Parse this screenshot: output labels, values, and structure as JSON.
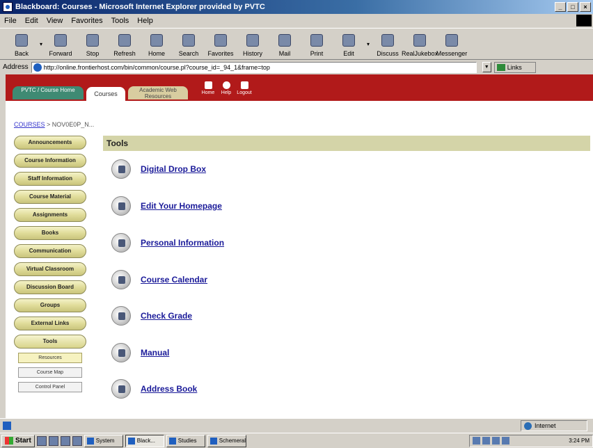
{
  "window": {
    "title": "Blackboard: Courses - Microsoft Internet Explorer provided by PVTC",
    "buttons": [
      "_",
      "□",
      "×"
    ]
  },
  "menu": [
    "File",
    "Edit",
    "View",
    "Favorites",
    "Tools",
    "Help"
  ],
  "toolbar": {
    "items": [
      {
        "label": "Back",
        "icon": "back-arrow-icon"
      },
      {
        "label": "Forward",
        "icon": "forward-arrow-icon"
      },
      {
        "label": "Stop",
        "icon": "stop-icon"
      },
      {
        "label": "Refresh",
        "icon": "refresh-icon"
      },
      {
        "label": "Home",
        "icon": "home-icon"
      },
      {
        "label": "Search",
        "icon": "search-icon"
      },
      {
        "label": "Favorites",
        "icon": "favorites-icon"
      },
      {
        "label": "History",
        "icon": "history-icon"
      },
      {
        "label": "Mail",
        "icon": "mail-icon"
      },
      {
        "label": "Print",
        "icon": "print-icon"
      },
      {
        "label": "Edit",
        "icon": "edit-icon"
      },
      {
        "label": "Discuss",
        "icon": "discuss-icon"
      },
      {
        "label": "RealJukebox",
        "icon": "jukebox-icon"
      },
      {
        "label": "Messenger",
        "icon": "messenger-icon"
      }
    ]
  },
  "address": {
    "label": "Address",
    "url": "http://online.frontierhost.com/bin/common/course.pl?course_id=_94_1&frame=top",
    "go_label": "Links"
  },
  "nav": {
    "tabs": [
      "PVTC / Course Home",
      "Courses",
      "Academic Web Resources"
    ],
    "icons": [
      {
        "label": "Home",
        "icon": "home-icon"
      },
      {
        "label": "Help",
        "icon": "help-icon"
      },
      {
        "label": "Logout",
        "icon": "logout-icon"
      }
    ]
  },
  "breadcrumb": {
    "root": "COURSES",
    "separator": " > ",
    "current": "NOV0E0P_N..."
  },
  "leftmenu": {
    "items": [
      "Announcements",
      "Course Information",
      "Staff Information",
      "Course Material",
      "Assignments",
      "Books",
      "Communication",
      "Virtual Classroom",
      "Discussion Board",
      "Groups",
      "External Links",
      "Tools"
    ],
    "subitems": [
      "Resources",
      "Course Map",
      "Control Panel"
    ]
  },
  "tools": {
    "header": "Tools",
    "items": [
      "Digital Drop Box",
      "Edit Your Homepage",
      "Personal Information",
      "Course Calendar",
      "Check Grade",
      "Manual",
      "Address Book"
    ]
  },
  "status": {
    "zone": "Internet"
  },
  "taskbar": {
    "start": "Start",
    "tasks": [
      "System",
      "Black...",
      "Studies",
      "Schemeral"
    ],
    "clock": "3:24 PM"
  },
  "colors": {
    "nav_red": "#b11a1a",
    "menu_gold": "#e0dc9a",
    "tools_header": "#d4d4a8",
    "link_blue": "#1a1a99"
  }
}
